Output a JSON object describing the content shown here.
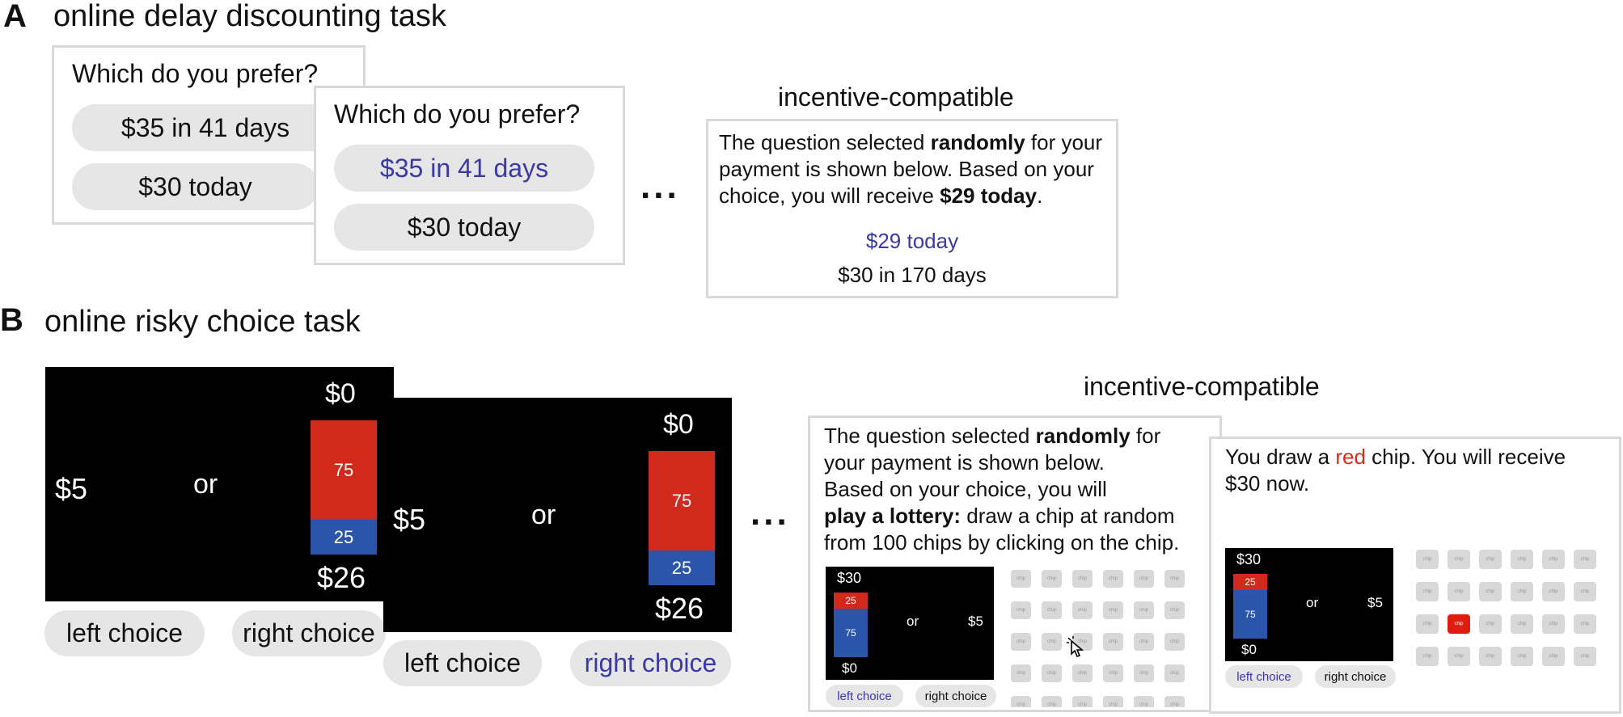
{
  "panelA": {
    "letter": "A",
    "title": "online delay discounting task",
    "card1": {
      "question": "Which do you  prefer?",
      "option1": "$35 in 41 days",
      "option2": "$30 today"
    },
    "card2": {
      "question": "Which do you  prefer?",
      "option1": "$35 in 41 days",
      "option2": "$30 today"
    },
    "ellipsis": "...",
    "incentive_title": "incentive-compatible",
    "result": {
      "text1": "The question selected ",
      "bold1": "randomly",
      "text2": " for your payment is shown below. Based on your choice, you will receive ",
      "bold2": "$29 today",
      "text3": ".",
      "chosen": "$29 today",
      "other": "$30 in 170 days"
    }
  },
  "panelB": {
    "letter": "B",
    "title": "online risky choice task",
    "screen1": {
      "left_amount": "$5",
      "or": "or",
      "top": "$0",
      "red_pct": "75",
      "blue_pct": "25",
      "bottom": "$26",
      "left_button": "left choice",
      "right_button": "right choice"
    },
    "screen2": {
      "left_amount": "$5",
      "or": "or",
      "top": "$0",
      "red_pct": "75",
      "blue_pct": "25",
      "bottom": "$26",
      "left_button": "left choice",
      "right_button": "right choice"
    },
    "ellipsis": "...",
    "incentive_title": "incentive-compatible",
    "lottery_card": {
      "line1a": "The question selected ",
      "line1b": "randomly",
      "line1c": " for",
      "line2": "your payment is shown below.",
      "line3": "Based on your choice, you will",
      "line4a": "play a lottery:",
      "line4b": " draw a chip at random",
      "line5": "from 100 chips by clicking on the chip.",
      "mini": {
        "top": "$30",
        "red_pct": "25",
        "blue_pct": "75",
        "bottom": "$0",
        "or": "or",
        "right": "$5",
        "left_button": "left choice",
        "right_button": "right choice"
      },
      "chip_label": "chip"
    },
    "draw_card": {
      "text1": "You draw a ",
      "red_word": "red",
      "text2": " chip. You will receive",
      "text3": "$30 now.",
      "mini": {
        "top": "$30",
        "red_pct": "25",
        "blue_pct": "75",
        "bottom": "$0",
        "or": "or",
        "right": "$5",
        "left_button": "left choice",
        "right_button": "right choice"
      },
      "chip_label": "chip"
    }
  },
  "colors": {
    "red": "#d12a1d",
    "blue_bar": "#2b54ab",
    "selected_text": "#3b38a8",
    "pill": "#e6e6e6"
  }
}
